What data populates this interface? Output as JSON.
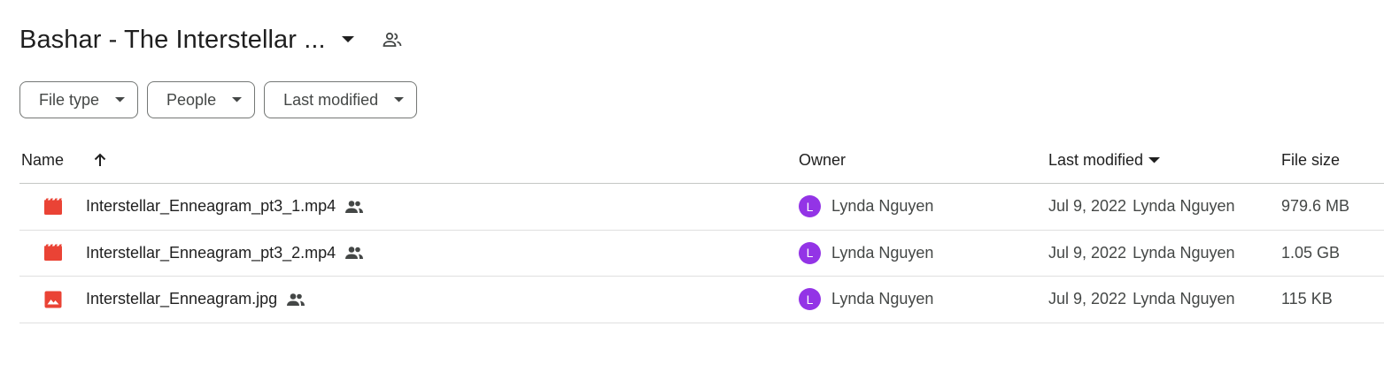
{
  "header": {
    "title": "Bashar - The Interstellar ...",
    "caret_icon": "arrow-drop-down-icon",
    "shared_icon": "people-outline-icon"
  },
  "filters": [
    {
      "label": "File type"
    },
    {
      "label": "People"
    },
    {
      "label": "Last modified"
    }
  ],
  "table": {
    "columns": {
      "name": "Name",
      "owner": "Owner",
      "last_modified": "Last modified",
      "file_size": "File size"
    },
    "sort": {
      "column": "Name",
      "direction": "ascending",
      "icon": "arrow-up-icon"
    },
    "rows": [
      {
        "name": "Interstellar_Enneagram_pt3_1.mp4",
        "file_icon": "video-file-icon",
        "shared": true,
        "owner": "Lynda Nguyen",
        "owner_initial": "L",
        "modified_date": "Jul 9, 2022",
        "modified_by": "Lynda Nguyen",
        "size": "979.6 MB"
      },
      {
        "name": "Interstellar_Enneagram_pt3_2.mp4",
        "file_icon": "video-file-icon",
        "shared": true,
        "owner": "Lynda Nguyen",
        "owner_initial": "L",
        "modified_date": "Jul 9, 2022",
        "modified_by": "Lynda Nguyen",
        "size": "1.05 GB"
      },
      {
        "name": "Interstellar_Enneagram.jpg",
        "file_icon": "image-file-icon",
        "shared": true,
        "owner": "Lynda Nguyen",
        "owner_initial": "L",
        "modified_date": "Jul 9, 2022",
        "modified_by": "Lynda Nguyen",
        "size": "115 KB"
      }
    ]
  },
  "colors": {
    "file_icon_red": "#ea4335",
    "avatar_purple": "#9334e6",
    "text_primary": "#1f1f1f",
    "text_secondary": "#444746"
  }
}
